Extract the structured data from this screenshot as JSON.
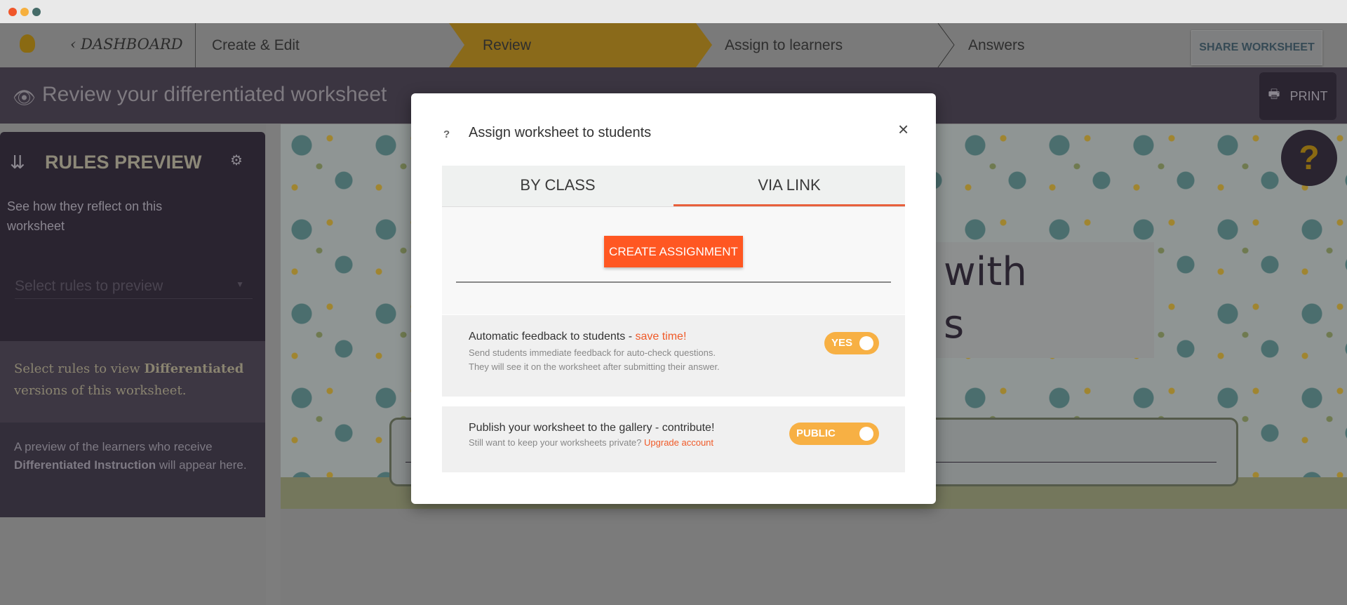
{
  "window": {
    "controls": [
      "close",
      "minimize",
      "maximize"
    ]
  },
  "nav": {
    "dashboard": "DASHBOARD",
    "steps": [
      "Create & Edit",
      "Review",
      "Assign to learners",
      "Answers"
    ],
    "active_step": "Review",
    "share": "SHARE WORKSHEET"
  },
  "header": {
    "title": "Review your differentiated worksheet",
    "print": "PRINT"
  },
  "sidebar": {
    "title": "RULES PREVIEW",
    "subtitle": "See how they reflect on this worksheet",
    "select_placeholder": "Select rules to preview",
    "info_pre": "Select rules to view ",
    "info_bold": "Differentiated",
    "info_post": " versions of this worksheet.",
    "preview_pre": "A preview of the learners who receive ",
    "preview_bold": "Differentiated Instruction",
    "preview_post": " will appear here."
  },
  "worksheet": {
    "title_line1": "with",
    "title_line2": "s"
  },
  "help": {
    "label": "?"
  },
  "dialog": {
    "help": "?",
    "title": "Assign worksheet to students",
    "close": "×",
    "tabs": [
      "BY CLASS",
      "VIA LINK"
    ],
    "active_tab": "VIA LINK",
    "create": "CREATE ASSIGNMENT",
    "feedback": {
      "title": "Automatic feedback to students - ",
      "highlight": "save time!",
      "line1": "Send students immediate feedback for auto-check questions.",
      "line2": "They will see it on the worksheet after submitting their answer.",
      "toggle": "YES"
    },
    "publish": {
      "title": "Publish your worksheet to the gallery - contribute!",
      "sub": "Still want to keep your worksheets private? ",
      "link": "Upgrade account",
      "toggle": "PUBLIC"
    }
  },
  "colors": {
    "accent": "#ff5722",
    "toggle": "#f7b044",
    "review_step": "#8a6a1a"
  }
}
